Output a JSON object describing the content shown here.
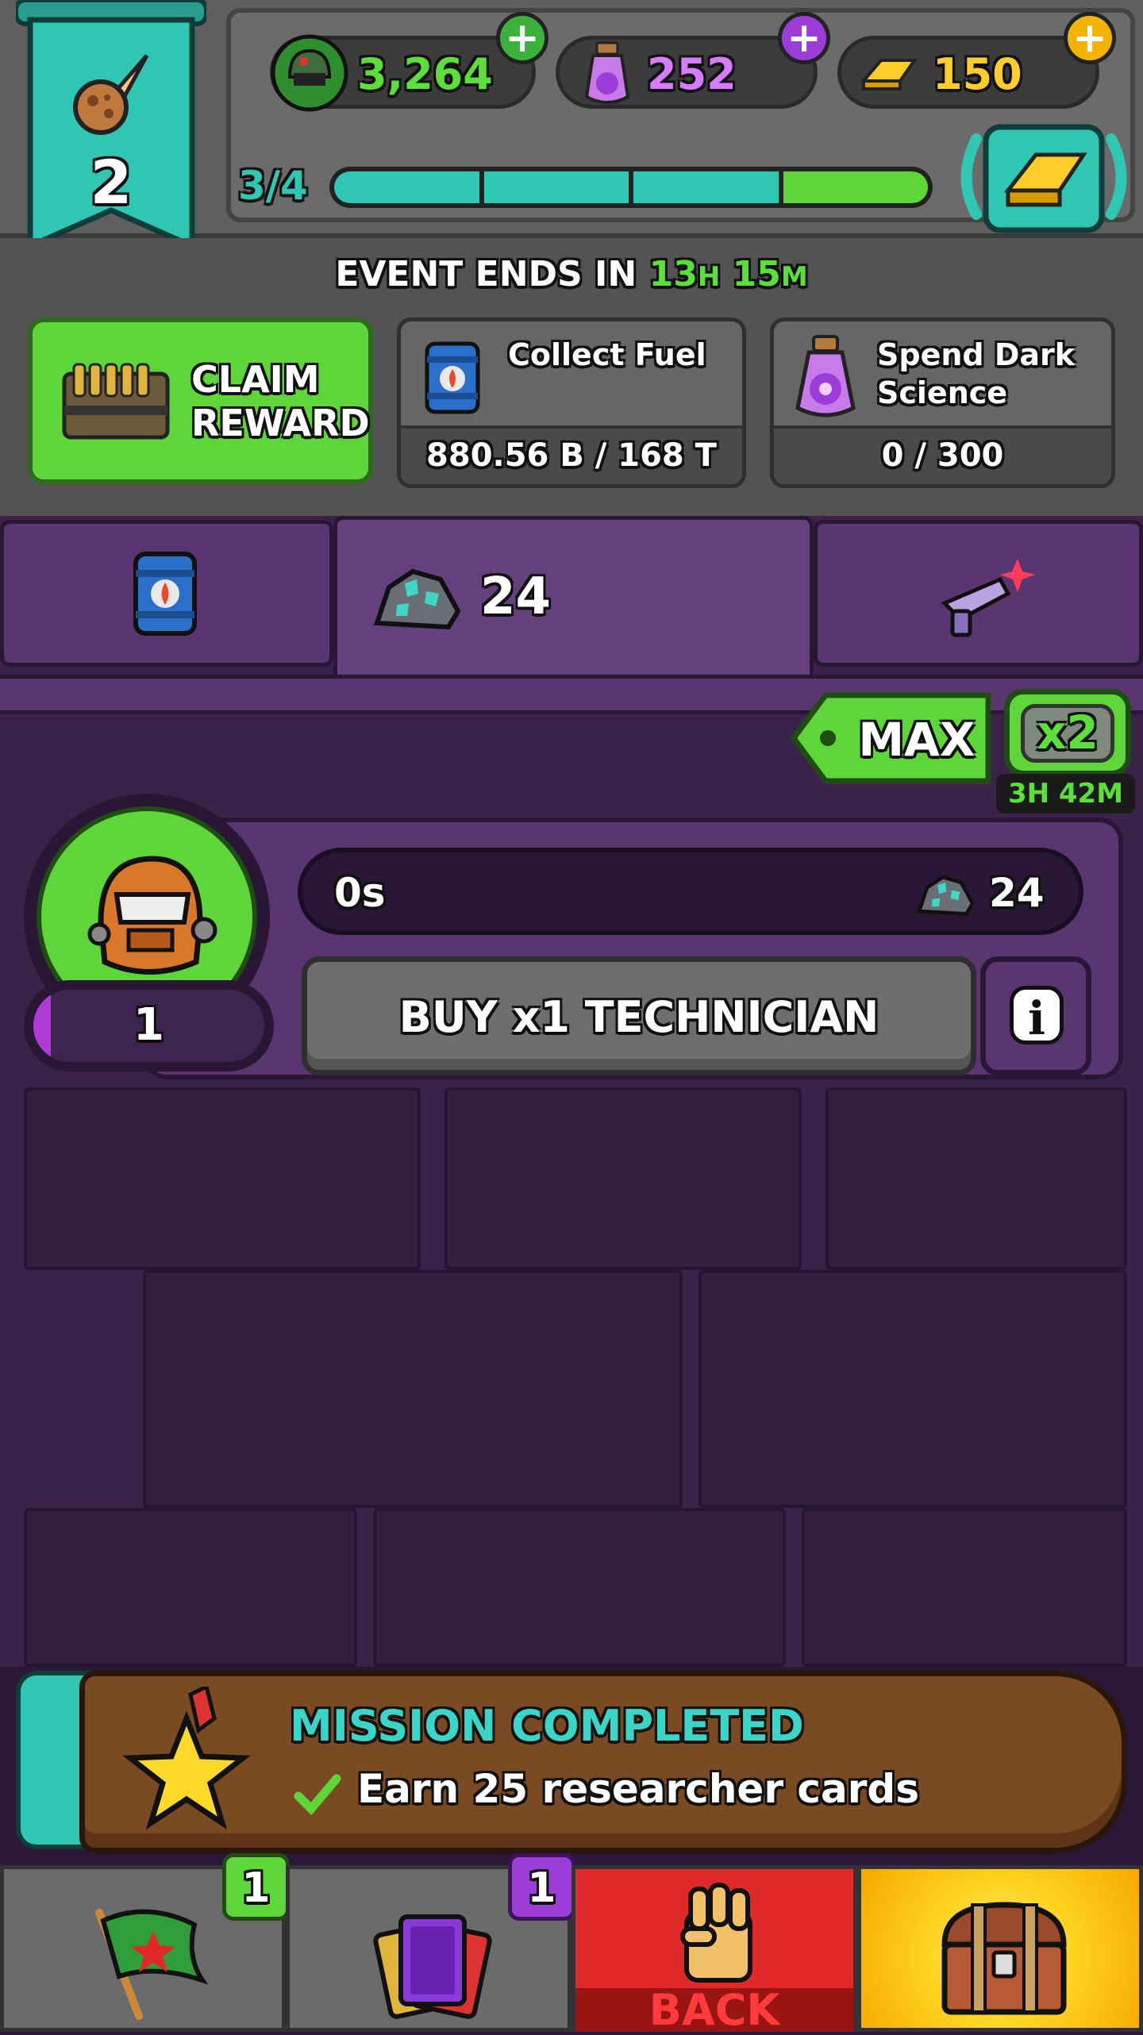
{
  "level": {
    "number": "2",
    "icon": "meteor-icon"
  },
  "currencies": [
    {
      "name": "soldiers",
      "value": "3,264",
      "color": "#5be03a",
      "icon": "soldier-helmet-icon",
      "plus_color": "#3cb23c"
    },
    {
      "name": "dark-science",
      "value": "252",
      "color": "#d77bff",
      "icon": "potion-icon",
      "plus_color": "#9b3dd6"
    },
    {
      "name": "gold",
      "value": "150",
      "color": "#ffcd2a",
      "icon": "gold-bar-icon",
      "plus_color": "#f2b400"
    }
  ],
  "progress": {
    "label": "3/4",
    "filled": 3,
    "total": 4
  },
  "event": {
    "prefix": "EVENT ENDS IN",
    "time_h": "13",
    "unit_h": "H",
    "time_m": "15",
    "unit_m": "M"
  },
  "tasks": {
    "claim": {
      "line1": "CLAIM",
      "line2": "REWARD"
    },
    "fuel": {
      "title": "Collect Fuel",
      "progress": "880.56 B / 168 T"
    },
    "science": {
      "title_line1": "Spend Dark",
      "title_line2": "Science",
      "progress": "0 / 300"
    }
  },
  "tabs": {
    "crystal_count": "24"
  },
  "boost": {
    "max_label": "MAX",
    "multiplier": "x2",
    "timer": "3H 42M"
  },
  "unit": {
    "level": "1",
    "timer": "0s",
    "cost": "24",
    "buy_label": "BUY x1 TECHNICIAN",
    "info_label": "i"
  },
  "mission": {
    "status": "MISSION COMPLETED",
    "description": "Earn 25 researcher cards"
  },
  "nav": {
    "missions_badge": "1",
    "cards_badge": "1",
    "back_label": "BACK"
  },
  "colors": {
    "green": "#5ed63a",
    "teal": "#2fc6b4",
    "red": "#e02a2a",
    "purple": "#3a2249"
  }
}
